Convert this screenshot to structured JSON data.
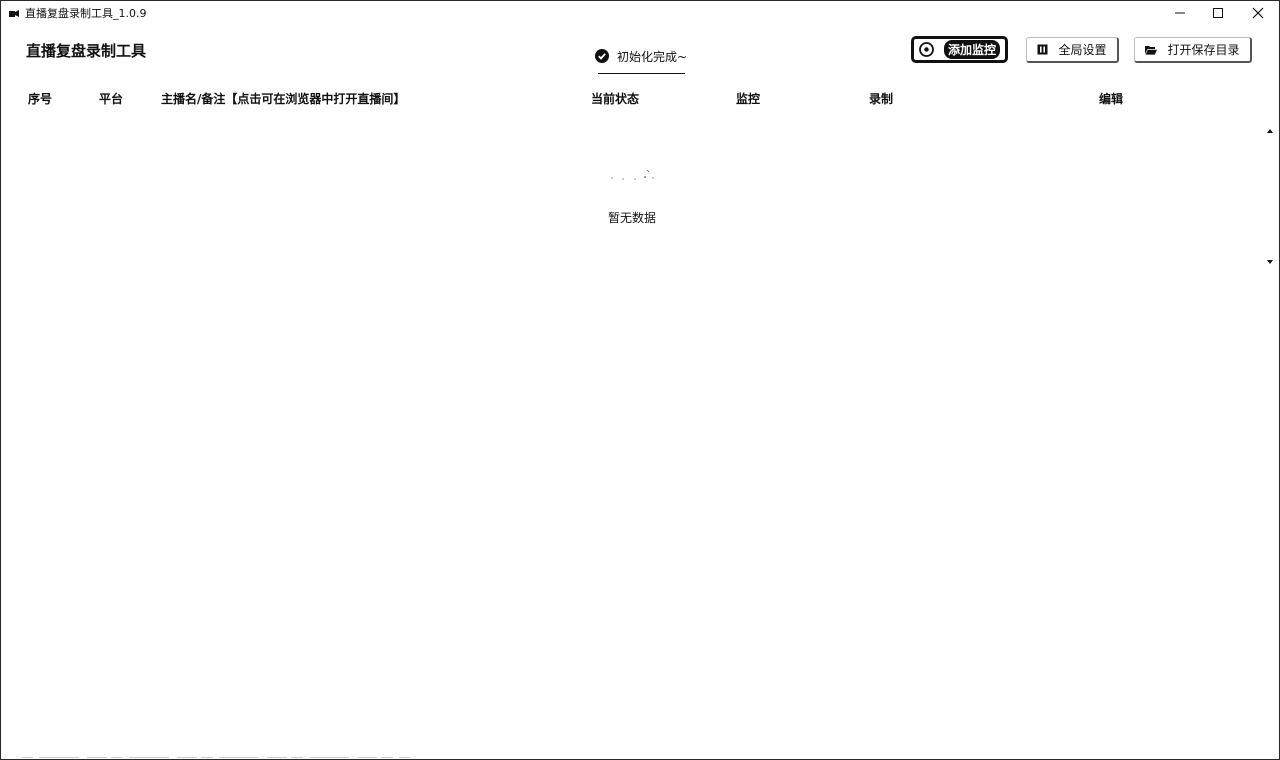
{
  "window": {
    "title": "直播复盘录制工具_1.0.9"
  },
  "header": {
    "app_title": "直播复盘录制工具",
    "status_text": "初始化完成~",
    "status_icon": "check-circle-icon"
  },
  "toolbar": {
    "add_monitor_label": "添加监控",
    "add_monitor_icon": "add-circle-icon",
    "global_settings_label": "全局设置",
    "global_settings_icon": "settings-icon",
    "open_folder_label": "打开保存目录",
    "open_folder_icon": "folder-open-icon"
  },
  "table": {
    "columns": [
      "序号",
      "平台",
      "主播名/备注【点击可在浏览器中打开直播间】",
      "当前状态",
      "监控",
      "录制",
      "编辑"
    ],
    "empty_text": "暂无数据"
  }
}
